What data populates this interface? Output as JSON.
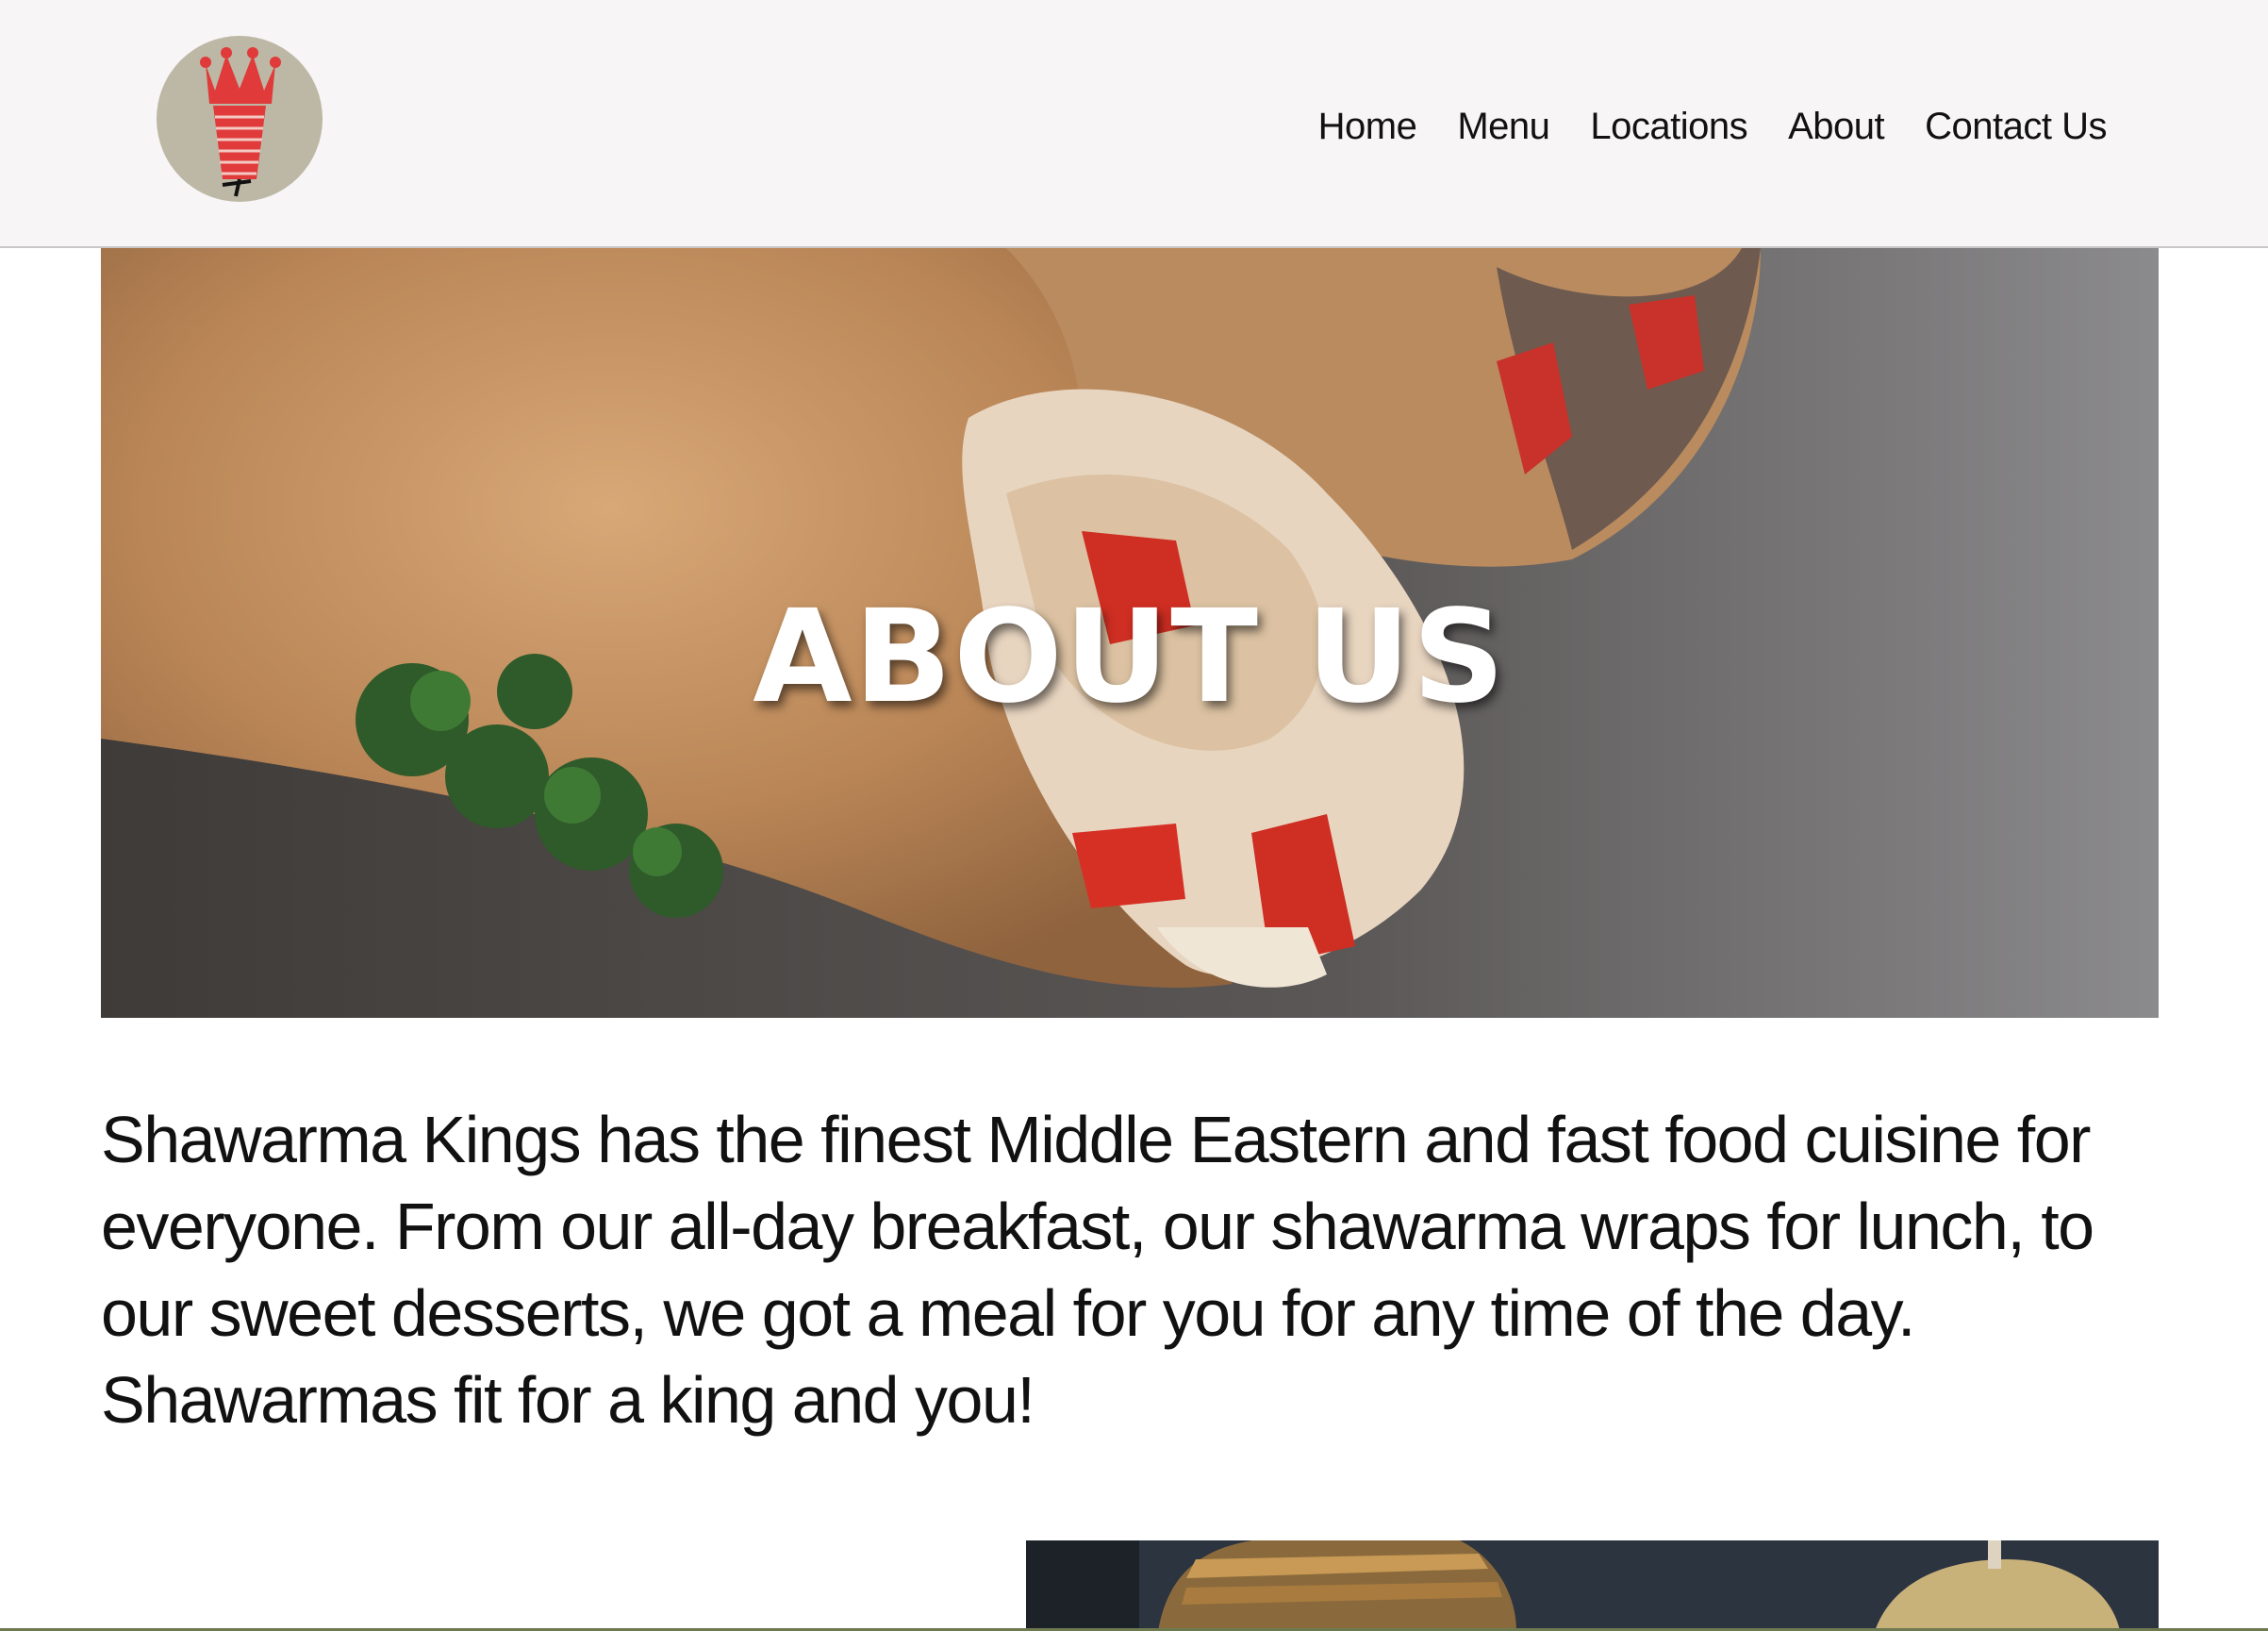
{
  "header": {
    "logo_icon": "crowned-shawarma-spit-icon",
    "nav": [
      {
        "label": "Home"
      },
      {
        "label": "Menu"
      },
      {
        "label": "Locations"
      },
      {
        "label": "About"
      },
      {
        "label": "Contact Us"
      }
    ]
  },
  "hero": {
    "title": "ABOUT US",
    "image": "shawarma-wrap-photo"
  },
  "about": {
    "text": "Shawarma Kings has the finest Middle Eastern and fast food cuisine for everyone. From our all-day breakfast, our shawarma wraps for lunch, to our sweet desserts, we got a meal for you for any time of the day. Shawarmas fit for a king and you!"
  },
  "gallery": {
    "image": "shawarma-spit-photo"
  },
  "colors": {
    "header_bg": "#f7f5f5",
    "logo_circle": "#bdb8a6",
    "logo_red": "#e03a3a",
    "text": "#111111"
  }
}
